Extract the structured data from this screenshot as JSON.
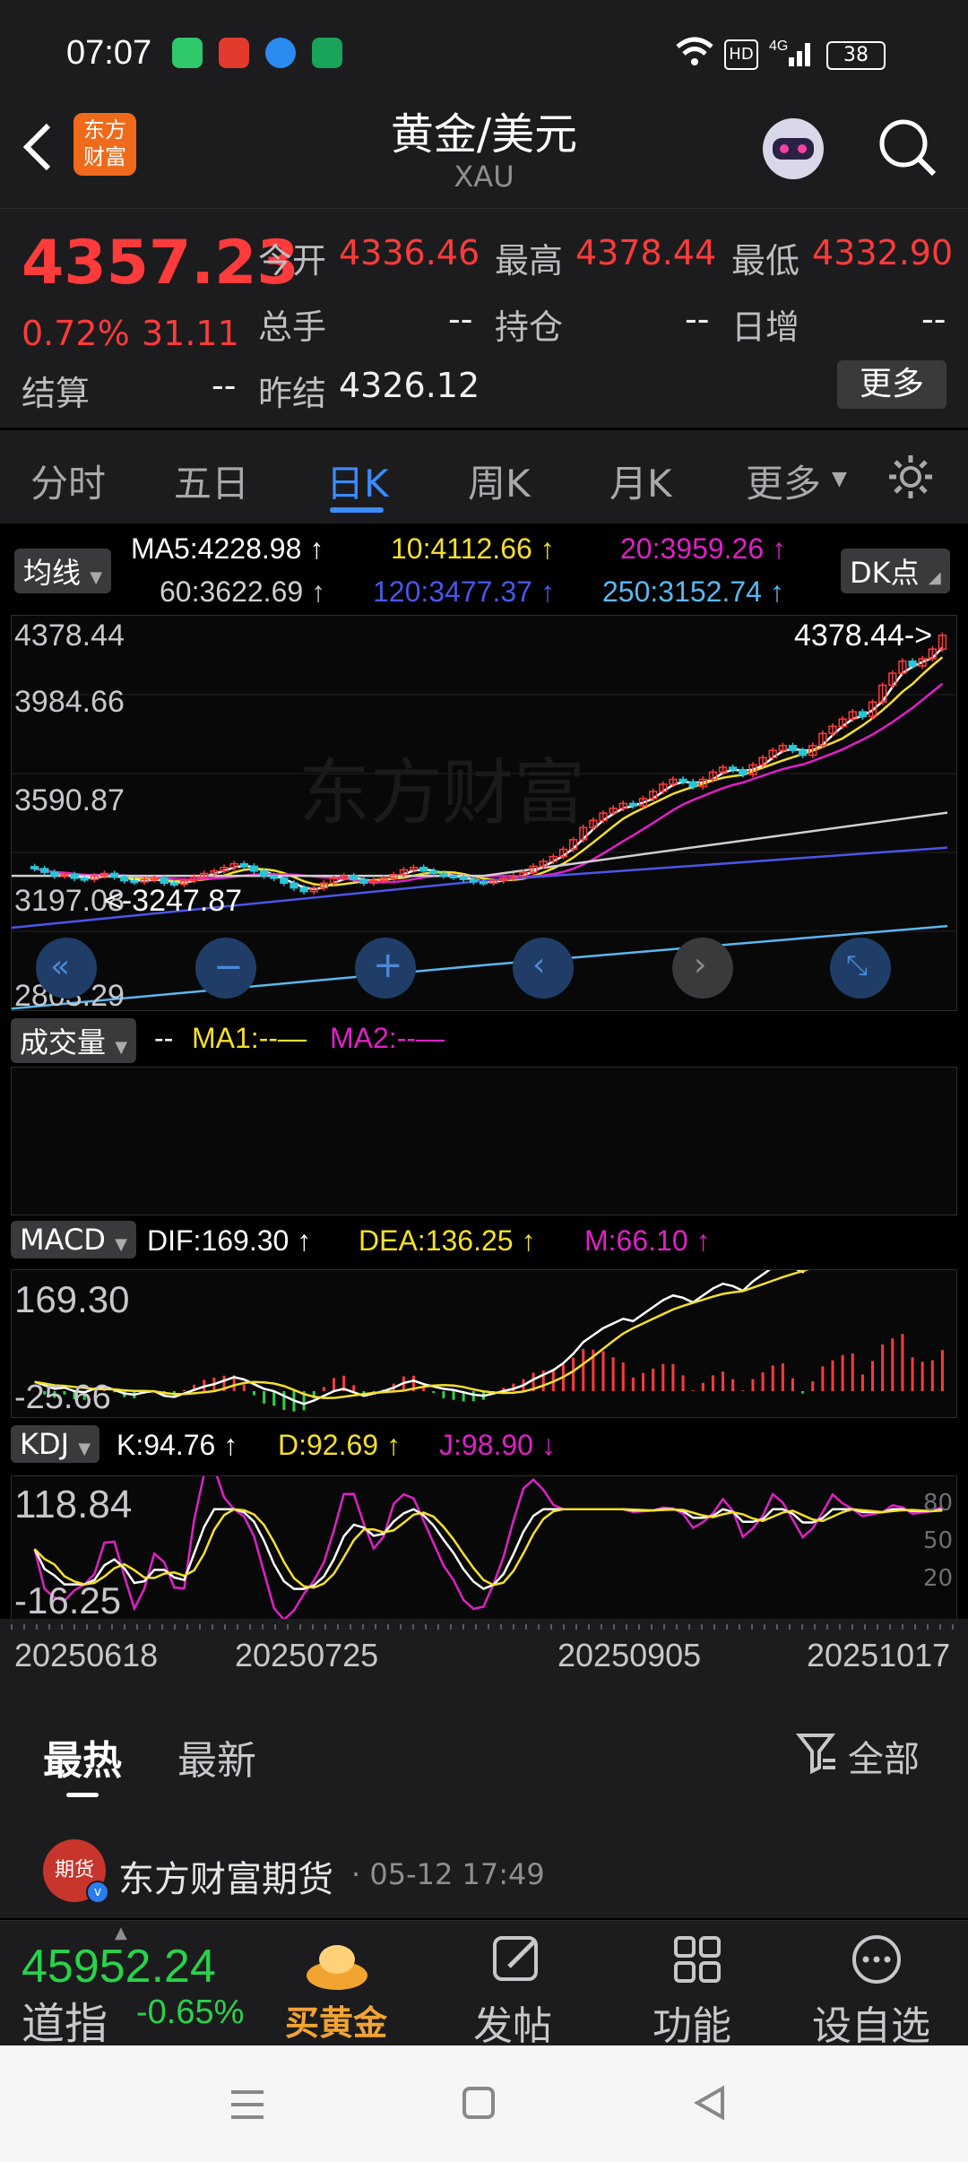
{
  "status_bar": {
    "time": "07:07",
    "battery": "38"
  },
  "header": {
    "title": "黄金/美元",
    "subtitle": "XAU",
    "logo_text": "东方财富"
  },
  "quote": {
    "price": "4357.23",
    "change_pct": "0.72%",
    "change": "31.11",
    "open_label": "今开",
    "open": "4336.46",
    "high_label": "最高",
    "high": "4378.44",
    "low_label": "最低",
    "low": "4332.90",
    "volume_label": "总手",
    "volume": "--",
    "oi_label": "持仓",
    "oi": "--",
    "daily_inc_label": "日增",
    "daily_inc": "--",
    "settle_label": "结算",
    "settle": "--",
    "prev_settle_label": "昨结",
    "prev_settle": "4326.12",
    "more_label": "更多"
  },
  "tabs": [
    {
      "label": "分时"
    },
    {
      "label": "五日"
    },
    {
      "label": "日K"
    },
    {
      "label": "周K"
    },
    {
      "label": "月K"
    },
    {
      "label": "更多"
    }
  ],
  "ma_legend": {
    "selector": "均线",
    "ma5": "MA5:4228.98",
    "ma10": "10:4112.66",
    "ma20": "20:3959.26",
    "ma60": "60:3622.69",
    "ma120": "120:3477.37",
    "ma250": "250:3152.74",
    "dk": "DK点",
    "colors": {
      "ma5": "#ffffff",
      "ma10": "#f5e02a",
      "ma20": "#e020c8",
      "ma60": "#d0d0d0",
      "ma120": "#4a56e8",
      "ma250": "#5ab8f0"
    }
  },
  "volume_legend": {
    "selector": "成交量",
    "dash": "--",
    "ma1": "MA1:--",
    "ma2": "MA2:--"
  },
  "macd_legend": {
    "selector": "MACD",
    "dif": "DIF:169.30",
    "dea": "DEA:136.25",
    "m": "M:66.10",
    "top_label": "169.30",
    "bottom_label": "-25.66"
  },
  "kdj_legend": {
    "selector": "KDJ",
    "k": "K:94.76",
    "d": "D:92.69",
    "j": "J:98.90",
    "top_label": "118.84",
    "bottom_label": "-16.25",
    "ref": [
      "80",
      "50",
      "20"
    ]
  },
  "dates": [
    "20250618",
    "20250725",
    "20250905",
    "20251017"
  ],
  "chart_data": {
    "type": "candlestick",
    "price_axis_ticks": [
      4378.44,
      3984.66,
      3590.87,
      3197.08,
      2803.29
    ],
    "max_label": "4378.44->",
    "min_label": "<-3247.87",
    "ylim": [
      2803.29,
      4378.44
    ],
    "close": [
      3390,
      3375,
      3360,
      3365,
      3350,
      3345,
      3360,
      3370,
      3355,
      3340,
      3335,
      3345,
      3350,
      3330,
      3325,
      3340,
      3355,
      3370,
      3380,
      3395,
      3410,
      3400,
      3380,
      3360,
      3350,
      3330,
      3310,
      3295,
      3310,
      3330,
      3350,
      3360,
      3345,
      3330,
      3340,
      3350,
      3365,
      3385,
      3395,
      3380,
      3370,
      3360,
      3355,
      3345,
      3335,
      3330,
      3340,
      3350,
      3360,
      3375,
      3400,
      3420,
      3440,
      3470,
      3510,
      3560,
      3590,
      3620,
      3640,
      3660,
      3650,
      3680,
      3710,
      3740,
      3760,
      3750,
      3730,
      3760,
      3790,
      3810,
      3800,
      3780,
      3820,
      3850,
      3880,
      3900,
      3880,
      3860,
      3900,
      3950,
      3980,
      4010,
      4040,
      4020,
      4080,
      4150,
      4200,
      4250,
      4230,
      4260,
      4300,
      4357
    ]
  },
  "sort_bar": {
    "hot": "最热",
    "new": "最新",
    "filter": "全部"
  },
  "post": {
    "author": "东方财富期货",
    "time": "· 05-12 17:49",
    "avatar_text": "期货"
  },
  "bottom_nav": {
    "index_value": "45952.24",
    "index_name": "道指",
    "index_change": "-0.65%",
    "buy_gold": "买黄金",
    "post": "发帖",
    "functions": "功能",
    "watchlist": "设自选"
  }
}
